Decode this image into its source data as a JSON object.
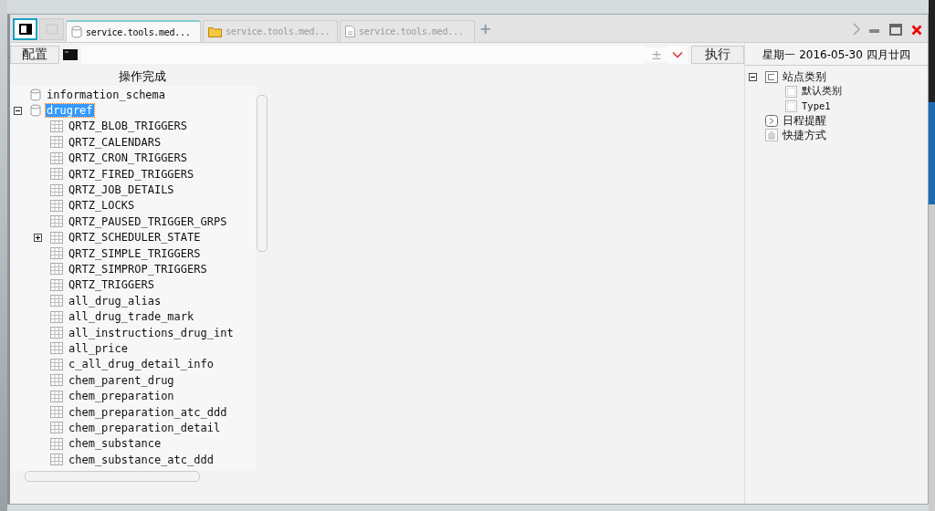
{
  "tabs": [
    {
      "kind": "panel",
      "selected": true
    },
    {
      "kind": "blank",
      "selected": false
    },
    {
      "kind": "database",
      "label": "service.tools.med...",
      "selected": true
    },
    {
      "kind": "folder",
      "label": "service.tools.med...",
      "selected": false
    },
    {
      "kind": "file",
      "label": "service.tools.med...",
      "selected": false
    }
  ],
  "new_tab": "+",
  "toolbar": {
    "config_button": "配置",
    "run_button": "执行",
    "plusminus": "±"
  },
  "date": "星期一 2016-05-30 四月廿四",
  "status": "操作完成",
  "tree": [
    {
      "label": "information_schema",
      "kind": "database",
      "selected": false
    },
    {
      "label": "drugref",
      "kind": "database",
      "selected": true,
      "expanded": true,
      "children": [
        {
          "label": "QRTZ_BLOB_TRIGGERS",
          "kind": "table",
          "selected": false
        },
        {
          "label": "QRTZ_CALENDARS",
          "kind": "table",
          "selected": false
        },
        {
          "label": "QRTZ_CRON_TRIGGERS",
          "kind": "table",
          "selected": false
        },
        {
          "label": "QRTZ_FIRED_TRIGGERS",
          "kind": "table",
          "selected": false
        },
        {
          "label": "QRTZ_JOB_DETAILS",
          "kind": "table",
          "selected": false
        },
        {
          "label": "QRTZ_LOCKS",
          "kind": "table",
          "selected": false
        },
        {
          "label": "QRTZ_PAUSED_TRIGGER_GRPS",
          "kind": "table",
          "selected": false
        },
        {
          "label": "QRTZ_SCHEDULER_STATE",
          "kind": "table",
          "selected": false,
          "expanded": false
        },
        {
          "label": "QRTZ_SIMPLE_TRIGGERS",
          "kind": "table",
          "selected": false
        },
        {
          "label": "QRTZ_SIMPROP_TRIGGERS",
          "kind": "table",
          "selected": false
        },
        {
          "label": "QRTZ_TRIGGERS",
          "kind": "table",
          "selected": false
        },
        {
          "label": "all_drug_alias",
          "kind": "table",
          "selected": false
        },
        {
          "label": "all_drug_trade_mark",
          "kind": "table",
          "selected": false
        },
        {
          "label": "all_instructions_drug_int",
          "kind": "table",
          "selected": false
        },
        {
          "label": "all_price",
          "kind": "table",
          "selected": false
        },
        {
          "label": "c_all_drug_detail_info",
          "kind": "table",
          "selected": false
        },
        {
          "label": "chem_parent_drug",
          "kind": "table",
          "selected": false
        },
        {
          "label": "chem_preparation",
          "kind": "table",
          "selected": false
        },
        {
          "label": "chem_preparation_atc_ddd",
          "kind": "table",
          "selected": false
        },
        {
          "label": "chem_preparation_detail",
          "kind": "table",
          "selected": false
        },
        {
          "label": "chem_substance",
          "kind": "table",
          "selected": false
        },
        {
          "label": "chem_substance_atc_ddd",
          "kind": "table",
          "selected": false
        }
      ]
    }
  ],
  "side_tree": [
    {
      "label": "站点类别",
      "kind": "category",
      "expanded": true,
      "children": [
        {
          "label": "默认类别",
          "kind": "item"
        },
        {
          "label": "Type1",
          "kind": "item"
        }
      ]
    },
    {
      "label": "日程提醒",
      "kind": "schedule"
    },
    {
      "label": "快捷方式",
      "kind": "shortcut"
    }
  ]
}
